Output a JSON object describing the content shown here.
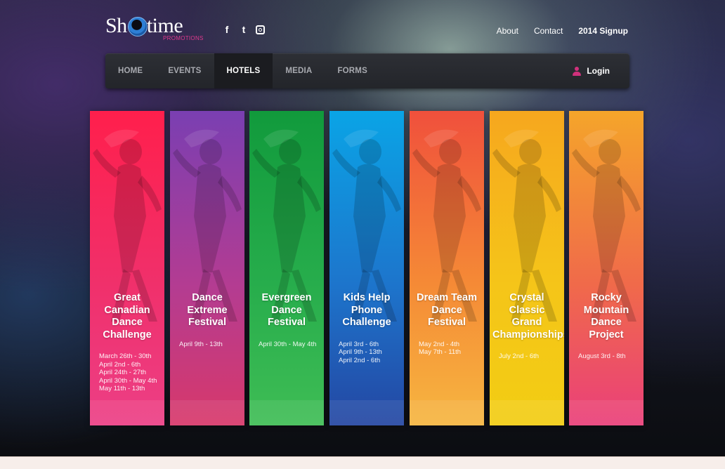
{
  "header": {
    "logo_text": "Sh  wtime",
    "logo_sub": "PROMOTIONS",
    "social": [
      {
        "icon": "facebook-icon",
        "glyph": "f"
      },
      {
        "icon": "twitter-icon",
        "glyph": "t"
      },
      {
        "icon": "instagram-icon",
        "glyph": ""
      }
    ],
    "links": {
      "about": "About",
      "contact": "Contact",
      "signup": "2014 Signup"
    }
  },
  "nav": {
    "items": [
      "HOME",
      "EVENTS",
      "HOTELS",
      "MEDIA",
      "FORMS"
    ],
    "active": "HOTELS",
    "login": "Login"
  },
  "colors": {
    "accent": "#d0317c",
    "panel_red": "#f0305f",
    "panel_purple": "#8a44b0",
    "panel_green": "#1ea64a",
    "panel_blue": "#1aa0e0",
    "panel_orange": "#f06a3a",
    "panel_yellow": "#f5b21a",
    "panel_pink_orange": "#f59a2c"
  },
  "events": [
    {
      "title": "Great Canadian Dance Challenge",
      "title_lines": [
        "Great",
        "Canadian",
        "Dance",
        "Challenge"
      ],
      "dates": [
        "March 26th - 30th",
        "April 2nd - 6th",
        "April 24th - 27th",
        "April 30th - May 4th",
        "May 11th - 13th"
      ]
    },
    {
      "title": "Dance Extreme Festival",
      "title_lines": [
        "Dance",
        "Extreme",
        "Festival"
      ],
      "dates": [
        "April 9th - 13th"
      ]
    },
    {
      "title": "Evergreen Dance Festival",
      "title_lines": [
        "Evergreen",
        "Dance",
        "Festival"
      ],
      "dates": [
        "April 30th - May 4th"
      ]
    },
    {
      "title": "Kids Help Phone Challenge",
      "title_lines": [
        "Kids Help",
        "Phone",
        "Challenge"
      ],
      "dates": [
        "April 3rd - 6th",
        "April 9th - 13th",
        "April 2nd - 6th"
      ]
    },
    {
      "title": "Dream Team Dance Festival",
      "title_lines": [
        "Dream Team",
        "Dance",
        "Festival"
      ],
      "dates": [
        "May 2nd - 4th",
        "May 7th - 11th"
      ]
    },
    {
      "title": "Crystal Classic Grand Championships",
      "title_lines": [
        "Crystal",
        "Classic",
        "Grand",
        "Championships"
      ],
      "dates": [
        "July 2nd - 6th"
      ]
    },
    {
      "title": "Rocky Mountain Dance Project",
      "title_lines": [
        "Rocky",
        "Mountain",
        "Dance",
        "Project"
      ],
      "dates": [
        "August 3rd - 8th"
      ]
    }
  ]
}
